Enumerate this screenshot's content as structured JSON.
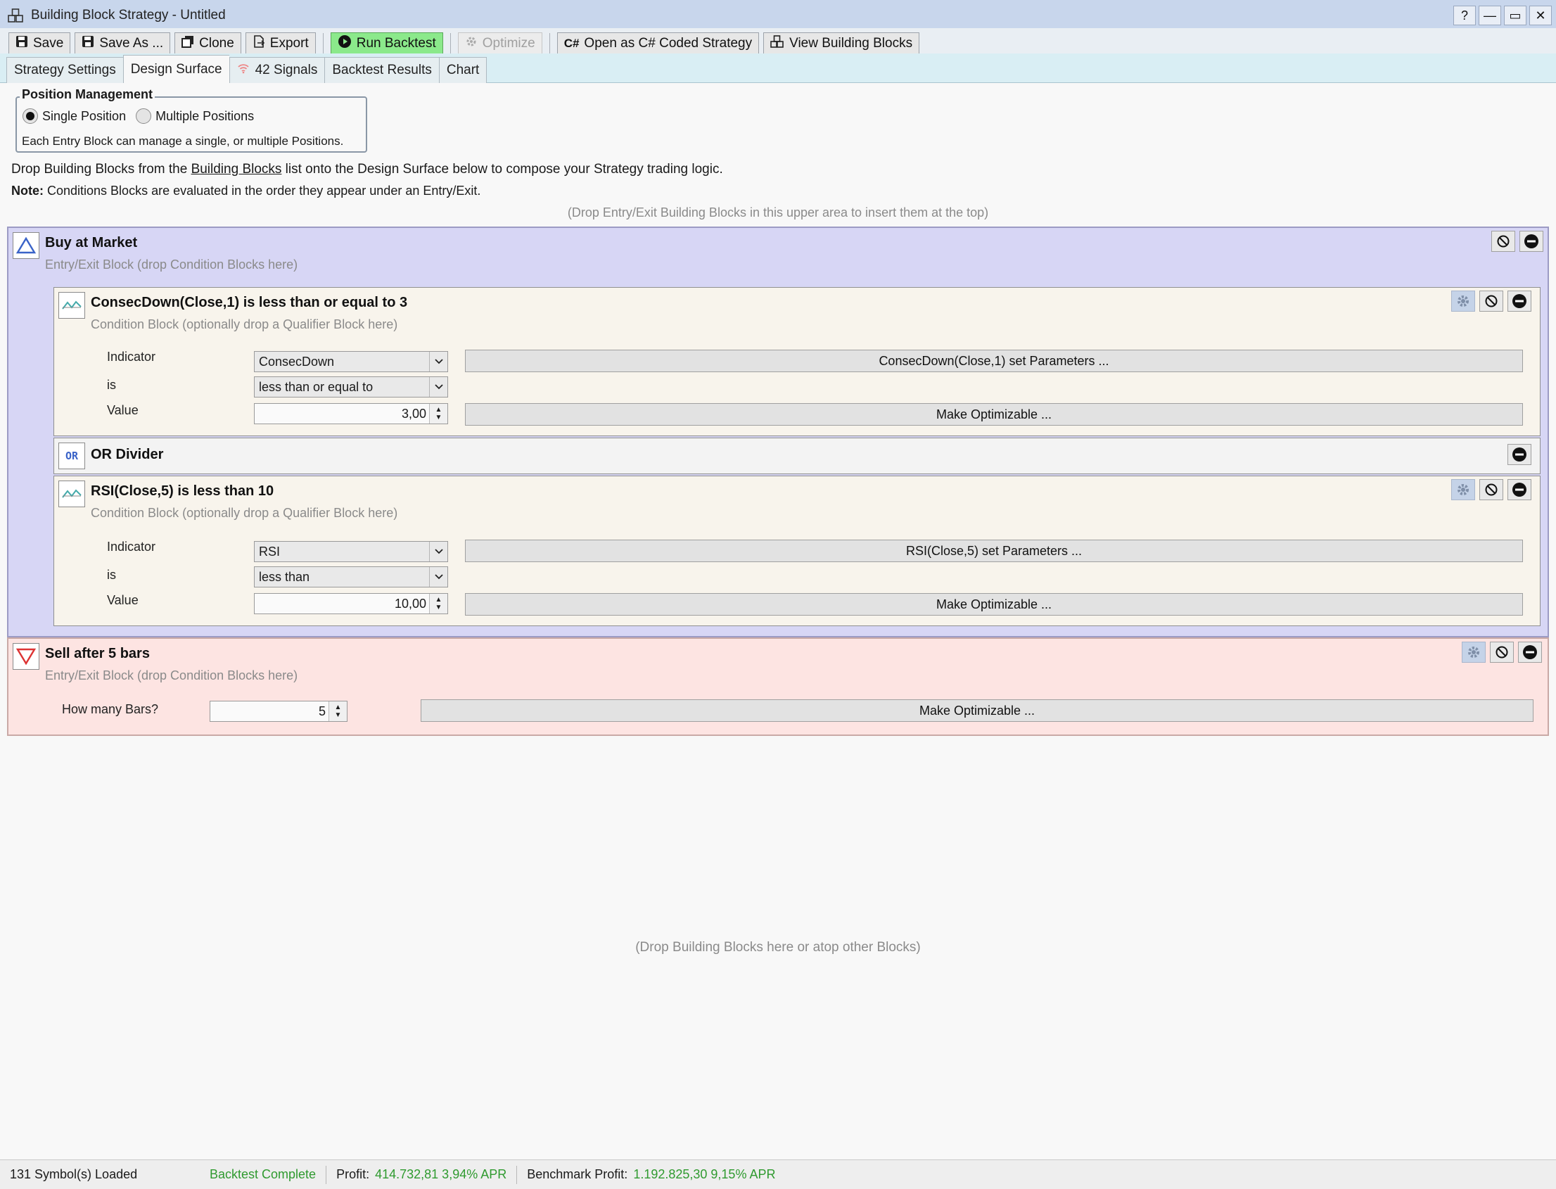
{
  "window": {
    "title": "Building Block Strategy - Untitled",
    "controls": [
      "?",
      "—",
      "▭",
      "✕"
    ]
  },
  "toolbar": {
    "save": "Save",
    "save_as": "Save As ...",
    "clone": "Clone",
    "export": "Export",
    "run_backtest": "Run Backtest",
    "optimize": "Optimize",
    "open_csharp": "Open as C# Coded Strategy",
    "view_blocks": "View Building Blocks",
    "colors": {
      "run_backtest_bg": "#8be98b"
    }
  },
  "tabs": {
    "strategy_settings": "Strategy Settings",
    "design_surface": "Design Surface",
    "signals": "42 Signals",
    "backtest_results": "Backtest Results",
    "chart": "Chart",
    "active": "Design Surface"
  },
  "position_management": {
    "legend": "Position Management",
    "single": "Single Position",
    "multiple": "Multiple Positions",
    "selected": "Single Position",
    "note": "Each Entry Block can manage a single, or multiple Positions."
  },
  "help": {
    "line1_prefix": "Drop Building Blocks from the ",
    "line1_link": "Building Blocks",
    "line1_suffix": " list onto the Design Surface below to compose your Strategy trading logic.",
    "note_label": "Note:",
    "note_text": " Conditions Blocks are evaluated in the order they appear under an Entry/Exit.",
    "drop_top": "(Drop Entry/Exit Building Blocks in this upper area to insert them at the top)",
    "drop_bottom": "(Drop Building Blocks here or atop other Blocks)"
  },
  "buy_block": {
    "title": "Buy at Market",
    "subtitle": "Entry/Exit Block (drop Condition Blocks here)",
    "bg_color": "#d7d6f5"
  },
  "condition1": {
    "title": "ConsecDown(Close,1) is less than or equal to 3",
    "subtitle": "Condition Block (optionally drop a Qualifier Block here)",
    "indicator_label": "Indicator",
    "indicator_value": "ConsecDown",
    "is_label": "is",
    "is_value": "less than or equal to",
    "value_label": "Value",
    "value": "3,00",
    "params_button": "ConsecDown(Close,1) set Parameters ...",
    "optimizable_button": "Make Optimizable ..."
  },
  "or_divider": {
    "title": "OR Divider",
    "icon_text": "OR"
  },
  "condition2": {
    "title": "RSI(Close,5) is less than 10",
    "subtitle": "Condition Block (optionally drop a Qualifier Block here)",
    "indicator_label": "Indicator",
    "indicator_value": "RSI",
    "is_label": "is",
    "is_value": "less than",
    "value_label": "Value",
    "value": "10,00",
    "params_button": "RSI(Close,5) set Parameters ...",
    "optimizable_button": "Make Optimizable ..."
  },
  "sell_block": {
    "title": "Sell after 5 bars",
    "subtitle": "Entry/Exit Block (drop Condition Blocks here)",
    "bars_label": "How many Bars?",
    "bars_value": "5",
    "optimizable_button": "Make Optimizable ...",
    "bg_color": "#fde4e2"
  },
  "status": {
    "symbols": "131 Symbol(s) Loaded",
    "backtest": "Backtest Complete",
    "profit_label": "Profit:",
    "profit_value": "414.732,81 3,94% APR",
    "benchmark_label": "Benchmark Profit:",
    "benchmark_value": "1.192.825,30 9,15% APR",
    "green": "#2f9a2f"
  }
}
